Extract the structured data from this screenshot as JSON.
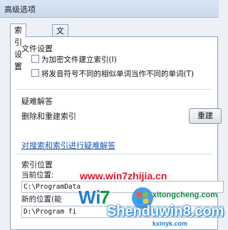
{
  "window": {
    "title": "高级选项"
  },
  "tabs": [
    {
      "label": "索引设置",
      "active": true
    },
    {
      "label": "文件类型",
      "active": false
    }
  ],
  "file_settings": {
    "title": "文件设置",
    "options": [
      {
        "label": "为加密文件建立索引(I)",
        "checked": false
      },
      {
        "label": "将发音符号不同的相似单词当作不同的单词(T)",
        "checked": false
      }
    ]
  },
  "troubleshoot": {
    "title": "疑难解答",
    "rebuild_text": "删除和重建索引",
    "rebuild_button": "重建",
    "help_link": "对搜索和索引进行疑难解答"
  },
  "index_location": {
    "title": "索引位置",
    "current_label": "当前位置:",
    "current_value": "C:\\ProgramData",
    "new_label": "新的位置(能",
    "new_value": "D:\\Program fi"
  },
  "watermarks": {
    "site1": "www.win7zhijia.cn",
    "site2": "Shenduwin8.com",
    "site3": "xitongcheng.com",
    "site4": "kxinyk.com"
  },
  "colors": {
    "link": "#1b56b3",
    "watermark_red": "#e0162b",
    "watermark_blue": "#1e7ecf"
  }
}
